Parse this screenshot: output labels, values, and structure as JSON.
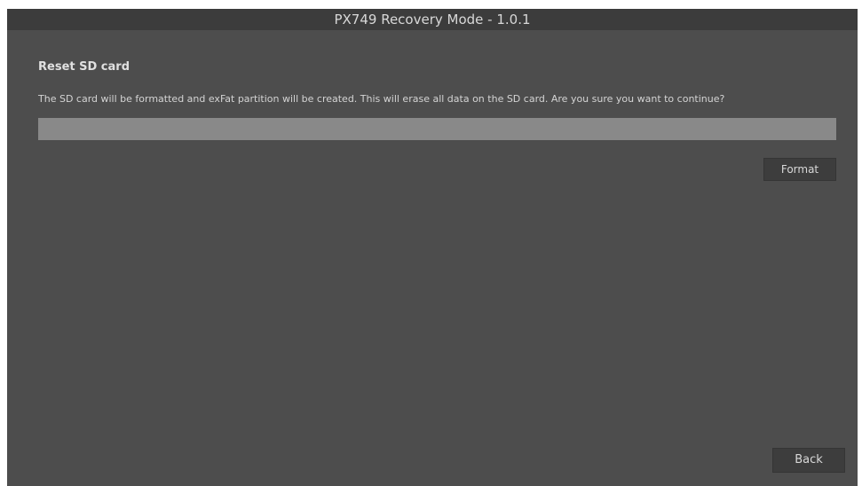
{
  "window": {
    "title": "PX749 Recovery Mode - 1.0.1"
  },
  "reset_sd": {
    "heading": "Reset SD card",
    "message": "The SD card will be formatted and exFat partition will be created. This will erase all data on the SD card. Are you sure you want to continue?",
    "progress_fraction": 0,
    "format_label": "Format"
  },
  "footer": {
    "back_label": "Back"
  },
  "colors": {
    "background": "#4d4d4d",
    "titlebar": "#3c3c3c",
    "progress_track": "#898989",
    "button": "#3d3d3d"
  }
}
